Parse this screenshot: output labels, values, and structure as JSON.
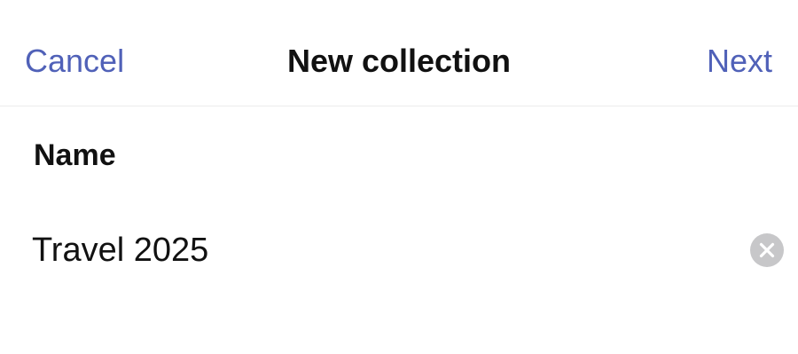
{
  "nav": {
    "cancel_label": "Cancel",
    "title": "New collection",
    "next_label": "Next"
  },
  "form": {
    "name_label": "Name",
    "name_value": "Travel 2025",
    "clear_icon": "clear-circle-icon"
  },
  "colors": {
    "accent": "#5061b8",
    "text": "#111111",
    "clear_button": "#c7c7c9",
    "divider": "#ececec"
  }
}
